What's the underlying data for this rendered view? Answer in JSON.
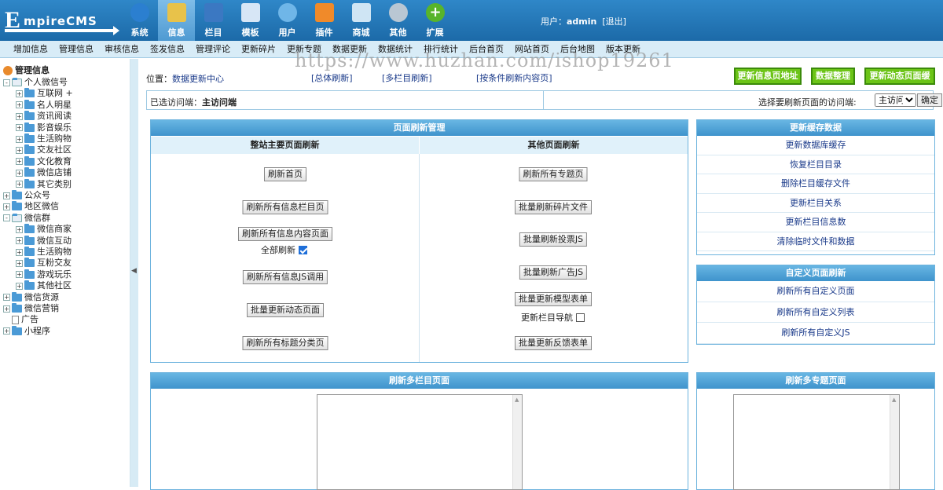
{
  "logo": {
    "big": "E",
    "rest": "mpireCMS"
  },
  "main_nav": [
    {
      "label": "系统",
      "icon": "globe-icon",
      "color": "#2b7fd0",
      "active": false
    },
    {
      "label": "信息",
      "icon": "note-edit-icon",
      "color": "#e8c24a",
      "active": true
    },
    {
      "label": "栏目",
      "icon": "folder-icon",
      "color": "#3b78c2",
      "active": false
    },
    {
      "label": "模板",
      "icon": "template-icon",
      "color": "#d7e6f6",
      "active": false
    },
    {
      "label": "用户",
      "icon": "user-icon",
      "color": "#6fb6e8",
      "active": false
    },
    {
      "label": "插件",
      "icon": "tools-icon",
      "color": "#f08a2a",
      "active": false
    },
    {
      "label": "商城",
      "icon": "card-icon",
      "color": "#cfe5f4",
      "active": false
    },
    {
      "label": "其他",
      "icon": "gear-icon",
      "color": "#b9c7d3",
      "active": false
    },
    {
      "label": "扩展",
      "icon": "plus-circle-icon",
      "color": "#58b42b",
      "active": false
    }
  ],
  "user": {
    "prefix": "用户：",
    "name": "admin",
    "logout": "[退出]"
  },
  "sub_nav": [
    "增加信息",
    "管理信息",
    "审核信息",
    "签发信息",
    "管理评论",
    "更新碎片",
    "更新专题",
    "数据更新",
    "数据统计",
    "排行统计",
    "后台首页",
    "网站首页",
    "后台地图",
    "版本更新"
  ],
  "watermark": "https://www.huzhan.com/ishop19261",
  "tree": {
    "root": "管理信息",
    "items": [
      {
        "label": "个人微信号",
        "level": 0,
        "pm": "-",
        "type": "open"
      },
      {
        "label": "互联网 +",
        "level": 1,
        "pm": "+",
        "type": "folder"
      },
      {
        "label": "名人明星",
        "level": 1,
        "pm": "+",
        "type": "folder"
      },
      {
        "label": "资讯阅读",
        "level": 1,
        "pm": "+",
        "type": "folder"
      },
      {
        "label": "影音娱乐",
        "level": 1,
        "pm": "+",
        "type": "folder"
      },
      {
        "label": "生活购物",
        "level": 1,
        "pm": "+",
        "type": "folder"
      },
      {
        "label": "交友社区",
        "level": 1,
        "pm": "+",
        "type": "folder"
      },
      {
        "label": "文化教育",
        "level": 1,
        "pm": "+",
        "type": "folder"
      },
      {
        "label": "微信店铺",
        "level": 1,
        "pm": "+",
        "type": "folder"
      },
      {
        "label": "其它类别",
        "level": 1,
        "pm": "+",
        "type": "folder"
      },
      {
        "label": "公众号",
        "level": 0,
        "pm": "+",
        "type": "folder"
      },
      {
        "label": "地区微信",
        "level": 0,
        "pm": "+",
        "type": "folder"
      },
      {
        "label": "微信群",
        "level": 0,
        "pm": "-",
        "type": "open"
      },
      {
        "label": "微信商家",
        "level": 1,
        "pm": "+",
        "type": "folder"
      },
      {
        "label": "微信互动",
        "level": 1,
        "pm": "+",
        "type": "folder"
      },
      {
        "label": "生活购物",
        "level": 1,
        "pm": "+",
        "type": "folder"
      },
      {
        "label": "互粉交友",
        "level": 1,
        "pm": "+",
        "type": "folder"
      },
      {
        "label": "游戏玩乐",
        "level": 1,
        "pm": "+",
        "type": "folder"
      },
      {
        "label": "其他社区",
        "level": 1,
        "pm": "+",
        "type": "folder"
      },
      {
        "label": "微信货源",
        "level": 0,
        "pm": "+",
        "type": "folder"
      },
      {
        "label": "微信营销",
        "level": 0,
        "pm": "+",
        "type": "folder"
      },
      {
        "label": "广告",
        "level": 0,
        "pm": "",
        "type": "page"
      },
      {
        "label": "小程序",
        "level": 0,
        "pm": "+",
        "type": "folder"
      }
    ]
  },
  "location": {
    "label": "位置：",
    "value": "数据更新中心"
  },
  "loc_links": [
    "[总体刷新]",
    "[多栏目刷新]",
    "[按条件刷新内容页]"
  ],
  "top_buttons": [
    "更新信息页地址",
    "数据整理",
    "更新动态页面缓存"
  ],
  "visit": {
    "selected_label": "已选访问端：",
    "selected_value": "主访问端",
    "choose_label": "选择要刷新页面的访问端:",
    "select_value": "主访问端",
    "ok": "确定"
  },
  "refresh_panel": {
    "title": "页面刷新管理",
    "left_head": "整站主要页面刷新",
    "right_head": "其他页面刷新",
    "left_buttons": [
      "刷新首页",
      "刷新所有信息栏目页",
      "刷新所有信息内容页面",
      "刷新所有信息JS调用",
      "批量更新动态页面",
      "刷新所有标题分类页"
    ],
    "left_check": {
      "label": "全部刷新",
      "checked": true
    },
    "right_buttons": [
      "刷新所有专题页",
      "批量刷新碎片文件",
      "批量刷新投票JS",
      "批量刷新广告JS",
      "批量更新模型表单",
      "批量更新反馈表单"
    ],
    "right_check": {
      "label": "更新栏目导航",
      "checked": false
    }
  },
  "cache_panel": {
    "title": "更新缓存数据",
    "items": [
      "更新数据库缓存",
      "恢复栏目目录",
      "删除栏目缓存文件",
      "更新栏目关系",
      "更新栏目信息数",
      "清除临时文件和数据"
    ]
  },
  "custom_panel": {
    "title": "自定义页面刷新",
    "items": [
      "刷新所有自定义页面",
      "刷新所有自定义列表",
      "刷新所有自定义JS"
    ]
  },
  "multi_column_panel": {
    "title": "刷新多栏目页面"
  },
  "multi_topic_panel": {
    "title": "刷新多专题页面"
  }
}
